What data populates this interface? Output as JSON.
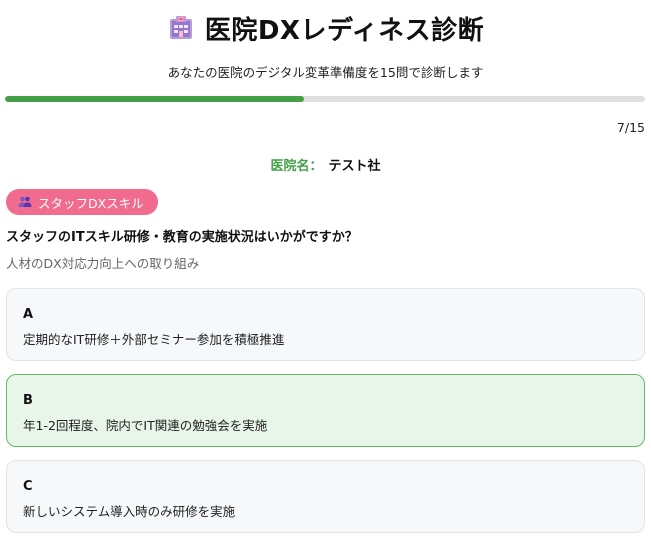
{
  "header": {
    "icon": "hospital-icon",
    "title": "医院DXレディネス診断",
    "subtitle": "あなたの医院のデジタル変革準備度を15問で診断します"
  },
  "progress": {
    "current": 7,
    "total": 15,
    "fraction": 0.467,
    "label": "7/15",
    "fill_color": "#43a047",
    "track_color": "#e0e0e0"
  },
  "clinic": {
    "label": "医院名：",
    "value": "テスト社"
  },
  "category": {
    "icon": "people-icon",
    "label": "スタッフDXスキル",
    "color": "#f06b8e"
  },
  "question": {
    "text": "スタッフのITスキル研修・教育の実施状況はいかがですか？",
    "hint": "人材のDX対応力向上への取り組み"
  },
  "options": [
    {
      "letter": "A",
      "text": "定期的なIT研修＋外部セミナー参加を積極推進",
      "selected": false
    },
    {
      "letter": "B",
      "text": "年1-2回程度、院内でIT関連の勉強会を実施",
      "selected": true
    },
    {
      "letter": "C",
      "text": "新しいシステム導入時のみ研修を実施",
      "selected": false
    }
  ],
  "colors": {
    "accent": "#43a047",
    "selected_bg": "#e8f5e9",
    "selected_border": "#66bb6a",
    "option_bg": "#f7f8fa"
  }
}
